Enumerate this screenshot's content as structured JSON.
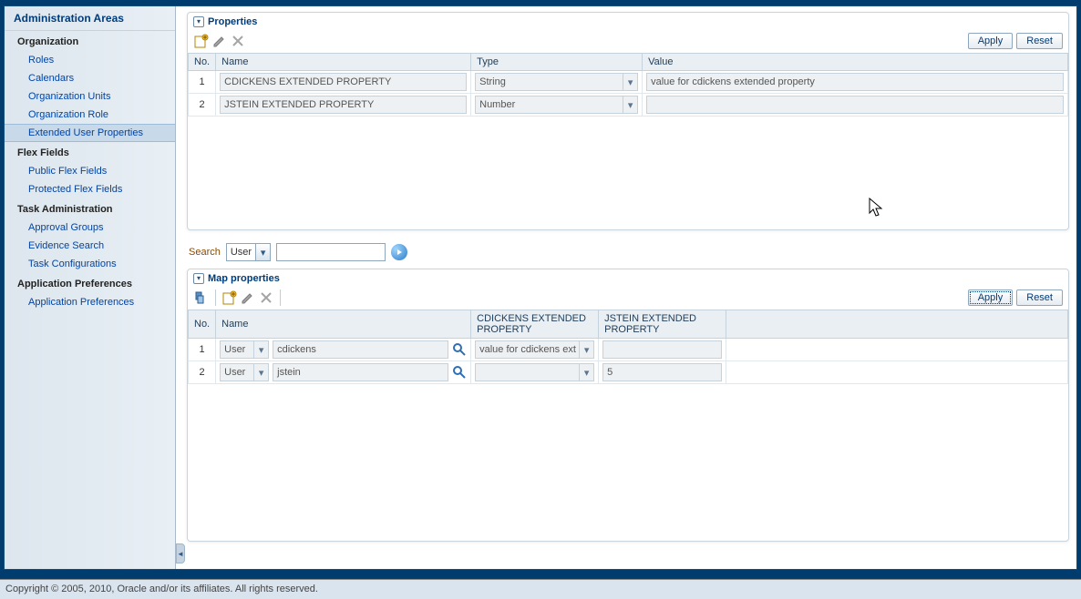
{
  "sidebar": {
    "title": "Administration Areas",
    "groups": [
      {
        "label": "Organization",
        "items": [
          {
            "label": "Roles"
          },
          {
            "label": "Calendars"
          },
          {
            "label": "Organization Units"
          },
          {
            "label": "Organization Role"
          },
          {
            "label": "Extended User Properties",
            "active": true
          }
        ]
      },
      {
        "label": "Flex Fields",
        "items": [
          {
            "label": "Public Flex Fields"
          },
          {
            "label": "Protected Flex Fields"
          }
        ]
      },
      {
        "label": "Task Administration",
        "items": [
          {
            "label": "Approval Groups"
          },
          {
            "label": "Evidence Search"
          },
          {
            "label": "Task Configurations"
          }
        ]
      },
      {
        "label": "Application Preferences",
        "items": [
          {
            "label": "Application Preferences"
          }
        ]
      }
    ]
  },
  "properties": {
    "title": "Properties",
    "apply": "Apply",
    "reset": "Reset",
    "headers": {
      "no": "No.",
      "name": "Name",
      "type": "Type",
      "value": "Value"
    },
    "rows": [
      {
        "no": "1",
        "name": "CDICKENS EXTENDED PROPERTY",
        "type": "String",
        "value": "value for cdickens extended property"
      },
      {
        "no": "2",
        "name": "JSTEIN EXTENDED PROPERTY",
        "type": "Number",
        "value": ""
      }
    ]
  },
  "search": {
    "label": "Search",
    "type": "User",
    "value": ""
  },
  "map": {
    "title": "Map properties",
    "apply": "Apply",
    "reset": "Reset",
    "headers": {
      "no": "No.",
      "name": "Name",
      "c1": "CDICKENS EXTENDED PROPERTY",
      "c2": "JSTEIN EXTENDED PROPERTY"
    },
    "rows": [
      {
        "no": "1",
        "type": "User",
        "name": "cdickens",
        "c1": "value for cdickens ext",
        "c2": ""
      },
      {
        "no": "2",
        "type": "User",
        "name": "jstein",
        "c1": "",
        "c2": "5"
      }
    ]
  },
  "footer": "Copyright © 2005, 2010, Oracle and/or its affiliates. All rights reserved."
}
